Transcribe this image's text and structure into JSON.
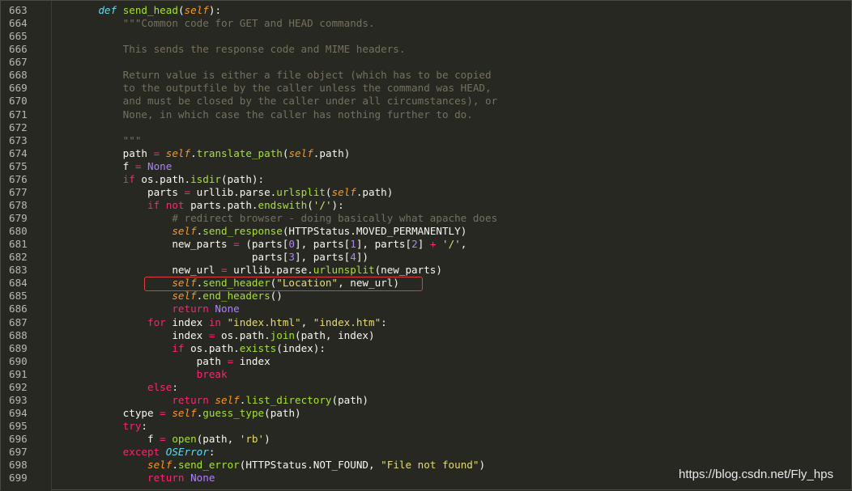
{
  "editor": {
    "colors": {
      "background": "#272822",
      "line_number": "#b8b8b0",
      "keyword": "#f92672",
      "function": "#a6e22e",
      "self": "#fd971f",
      "string": "#e6db74",
      "constant": "#ae81ff",
      "comment": "#75715e",
      "highlight_border": "#e03a3a"
    },
    "highlighted_line": 684,
    "lines": [
      {
        "n": "663",
        "tokens": [
          {
            "t": "    "
          },
          {
            "t": "def",
            "c": "def"
          },
          {
            "t": " "
          },
          {
            "t": "send_head",
            "c": "fn"
          },
          {
            "t": "("
          },
          {
            "t": "self",
            "c": "self"
          },
          {
            "t": "):"
          }
        ]
      },
      {
        "n": "664",
        "tokens": [
          {
            "t": "        "
          },
          {
            "t": "\"\"\"Common code for GET and HEAD commands.",
            "c": "doc"
          }
        ]
      },
      {
        "n": "665",
        "tokens": []
      },
      {
        "n": "666",
        "tokens": [
          {
            "t": "        "
          },
          {
            "t": "This sends the response code and MIME headers.",
            "c": "doc"
          }
        ]
      },
      {
        "n": "667",
        "tokens": []
      },
      {
        "n": "668",
        "tokens": [
          {
            "t": "        "
          },
          {
            "t": "Return value is either a file object (which has to be copied",
            "c": "doc"
          }
        ]
      },
      {
        "n": "669",
        "tokens": [
          {
            "t": "        "
          },
          {
            "t": "to the outputfile by the caller unless the command was HEAD,",
            "c": "doc"
          }
        ]
      },
      {
        "n": "670",
        "tokens": [
          {
            "t": "        "
          },
          {
            "t": "and must be closed by the caller under all circumstances), or",
            "c": "doc"
          }
        ]
      },
      {
        "n": "671",
        "tokens": [
          {
            "t": "        "
          },
          {
            "t": "None, in which case the caller has nothing further to do.",
            "c": "doc"
          }
        ]
      },
      {
        "n": "672",
        "tokens": []
      },
      {
        "n": "673",
        "tokens": [
          {
            "t": "        "
          },
          {
            "t": "\"\"\"",
            "c": "doc"
          }
        ]
      },
      {
        "n": "674",
        "tokens": [
          {
            "t": "        path "
          },
          {
            "t": "=",
            "c": "op"
          },
          {
            "t": " "
          },
          {
            "t": "self",
            "c": "self"
          },
          {
            "t": "."
          },
          {
            "t": "translate_path",
            "c": "fn"
          },
          {
            "t": "("
          },
          {
            "t": "self",
            "c": "self"
          },
          {
            "t": ".path)"
          }
        ]
      },
      {
        "n": "675",
        "tokens": [
          {
            "t": "        f "
          },
          {
            "t": "=",
            "c": "op"
          },
          {
            "t": " "
          },
          {
            "t": "None",
            "c": "const"
          }
        ]
      },
      {
        "n": "676",
        "tokens": [
          {
            "t": "        "
          },
          {
            "t": "if",
            "c": "kw"
          },
          {
            "t": " os.path."
          },
          {
            "t": "isdir",
            "c": "fn"
          },
          {
            "t": "(path):"
          }
        ]
      },
      {
        "n": "677",
        "tokens": [
          {
            "t": "            parts "
          },
          {
            "t": "=",
            "c": "op"
          },
          {
            "t": " urllib.parse."
          },
          {
            "t": "urlsplit",
            "c": "fn"
          },
          {
            "t": "("
          },
          {
            "t": "self",
            "c": "self"
          },
          {
            "t": ".path)"
          }
        ]
      },
      {
        "n": "678",
        "tokens": [
          {
            "t": "            "
          },
          {
            "t": "if",
            "c": "kw"
          },
          {
            "t": " "
          },
          {
            "t": "not",
            "c": "kw"
          },
          {
            "t": " parts.path."
          },
          {
            "t": "endswith",
            "c": "fn"
          },
          {
            "t": "("
          },
          {
            "t": "'/'",
            "c": "str"
          },
          {
            "t": "):"
          }
        ]
      },
      {
        "n": "679",
        "tokens": [
          {
            "t": "                "
          },
          {
            "t": "# redirect browser - doing basically what apache does",
            "c": "cmt"
          }
        ]
      },
      {
        "n": "680",
        "tokens": [
          {
            "t": "                "
          },
          {
            "t": "self",
            "c": "self"
          },
          {
            "t": "."
          },
          {
            "t": "send_response",
            "c": "fn"
          },
          {
            "t": "(HTTPStatus.MOVED_PERMANENTLY)"
          }
        ]
      },
      {
        "n": "681",
        "tokens": [
          {
            "t": "                new_parts "
          },
          {
            "t": "=",
            "c": "op"
          },
          {
            "t": " (parts["
          },
          {
            "t": "0",
            "c": "num"
          },
          {
            "t": "], parts["
          },
          {
            "t": "1",
            "c": "num"
          },
          {
            "t": "], parts["
          },
          {
            "t": "2",
            "c": "num"
          },
          {
            "t": "] "
          },
          {
            "t": "+",
            "c": "op"
          },
          {
            "t": " "
          },
          {
            "t": "'/'",
            "c": "str"
          },
          {
            "t": ","
          }
        ]
      },
      {
        "n": "682",
        "tokens": [
          {
            "t": "                             parts["
          },
          {
            "t": "3",
            "c": "num"
          },
          {
            "t": "], parts["
          },
          {
            "t": "4",
            "c": "num"
          },
          {
            "t": "])"
          }
        ]
      },
      {
        "n": "683",
        "tokens": [
          {
            "t": "                new_url "
          },
          {
            "t": "=",
            "c": "op"
          },
          {
            "t": " urllib.parse."
          },
          {
            "t": "urlunsplit",
            "c": "fn"
          },
          {
            "t": "(new_parts)"
          }
        ]
      },
      {
        "n": "684",
        "tokens": [
          {
            "t": "                "
          },
          {
            "t": "self",
            "c": "self"
          },
          {
            "t": "."
          },
          {
            "t": "send_header",
            "c": "fn"
          },
          {
            "t": "("
          },
          {
            "t": "\"Location\"",
            "c": "str"
          },
          {
            "t": ", new_url)"
          }
        ]
      },
      {
        "n": "685",
        "tokens": [
          {
            "t": "                "
          },
          {
            "t": "self",
            "c": "self"
          },
          {
            "t": "."
          },
          {
            "t": "end_headers",
            "c": "fn"
          },
          {
            "t": "()"
          }
        ]
      },
      {
        "n": "686",
        "tokens": [
          {
            "t": "                "
          },
          {
            "t": "return",
            "c": "kw"
          },
          {
            "t": " "
          },
          {
            "t": "None",
            "c": "const"
          }
        ]
      },
      {
        "n": "687",
        "tokens": [
          {
            "t": "            "
          },
          {
            "t": "for",
            "c": "kw"
          },
          {
            "t": " index "
          },
          {
            "t": "in",
            "c": "kw"
          },
          {
            "t": " "
          },
          {
            "t": "\"index.html\"",
            "c": "str"
          },
          {
            "t": ", "
          },
          {
            "t": "\"index.htm\"",
            "c": "str"
          },
          {
            "t": ":"
          }
        ]
      },
      {
        "n": "688",
        "tokens": [
          {
            "t": "                index "
          },
          {
            "t": "=",
            "c": "op"
          },
          {
            "t": " os.path."
          },
          {
            "t": "join",
            "c": "fn"
          },
          {
            "t": "(path, index)"
          }
        ]
      },
      {
        "n": "689",
        "tokens": [
          {
            "t": "                "
          },
          {
            "t": "if",
            "c": "kw"
          },
          {
            "t": " os.path."
          },
          {
            "t": "exists",
            "c": "fn"
          },
          {
            "t": "(index):"
          }
        ]
      },
      {
        "n": "690",
        "tokens": [
          {
            "t": "                    path "
          },
          {
            "t": "=",
            "c": "op"
          },
          {
            "t": " index"
          }
        ]
      },
      {
        "n": "691",
        "tokens": [
          {
            "t": "                    "
          },
          {
            "t": "break",
            "c": "kw"
          }
        ]
      },
      {
        "n": "692",
        "tokens": [
          {
            "t": "            "
          },
          {
            "t": "else",
            "c": "kw"
          },
          {
            "t": ":"
          }
        ]
      },
      {
        "n": "693",
        "tokens": [
          {
            "t": "                "
          },
          {
            "t": "return",
            "c": "kw"
          },
          {
            "t": " "
          },
          {
            "t": "self",
            "c": "self"
          },
          {
            "t": "."
          },
          {
            "t": "list_directory",
            "c": "fn"
          },
          {
            "t": "(path)"
          }
        ]
      },
      {
        "n": "694",
        "tokens": [
          {
            "t": "        ctype "
          },
          {
            "t": "=",
            "c": "op"
          },
          {
            "t": " "
          },
          {
            "t": "self",
            "c": "self"
          },
          {
            "t": "."
          },
          {
            "t": "guess_type",
            "c": "fn"
          },
          {
            "t": "(path)"
          }
        ]
      },
      {
        "n": "695",
        "tokens": [
          {
            "t": "        "
          },
          {
            "t": "try",
            "c": "kw"
          },
          {
            "t": ":"
          }
        ]
      },
      {
        "n": "696",
        "tokens": [
          {
            "t": "            f "
          },
          {
            "t": "=",
            "c": "op"
          },
          {
            "t": " "
          },
          {
            "t": "open",
            "c": "fn"
          },
          {
            "t": "(path, "
          },
          {
            "t": "'rb'",
            "c": "str"
          },
          {
            "t": ")"
          }
        ]
      },
      {
        "n": "697",
        "tokens": [
          {
            "t": "        "
          },
          {
            "t": "except",
            "c": "kw"
          },
          {
            "t": " "
          },
          {
            "t": "OSError",
            "c": "cls"
          },
          {
            "t": ":"
          }
        ]
      },
      {
        "n": "698",
        "tokens": [
          {
            "t": "            "
          },
          {
            "t": "self",
            "c": "self"
          },
          {
            "t": "."
          },
          {
            "t": "send_error",
            "c": "fn"
          },
          {
            "t": "(HTTPStatus.NOT_FOUND, "
          },
          {
            "t": "\"File not found\"",
            "c": "str"
          },
          {
            "t": ")"
          }
        ]
      },
      {
        "n": "699",
        "tokens": [
          {
            "t": "            "
          },
          {
            "t": "return",
            "c": "kw"
          },
          {
            "t": " "
          },
          {
            "t": "None",
            "c": "const"
          }
        ]
      }
    ]
  },
  "watermark": "https://blog.csdn.net/Fly_hps"
}
